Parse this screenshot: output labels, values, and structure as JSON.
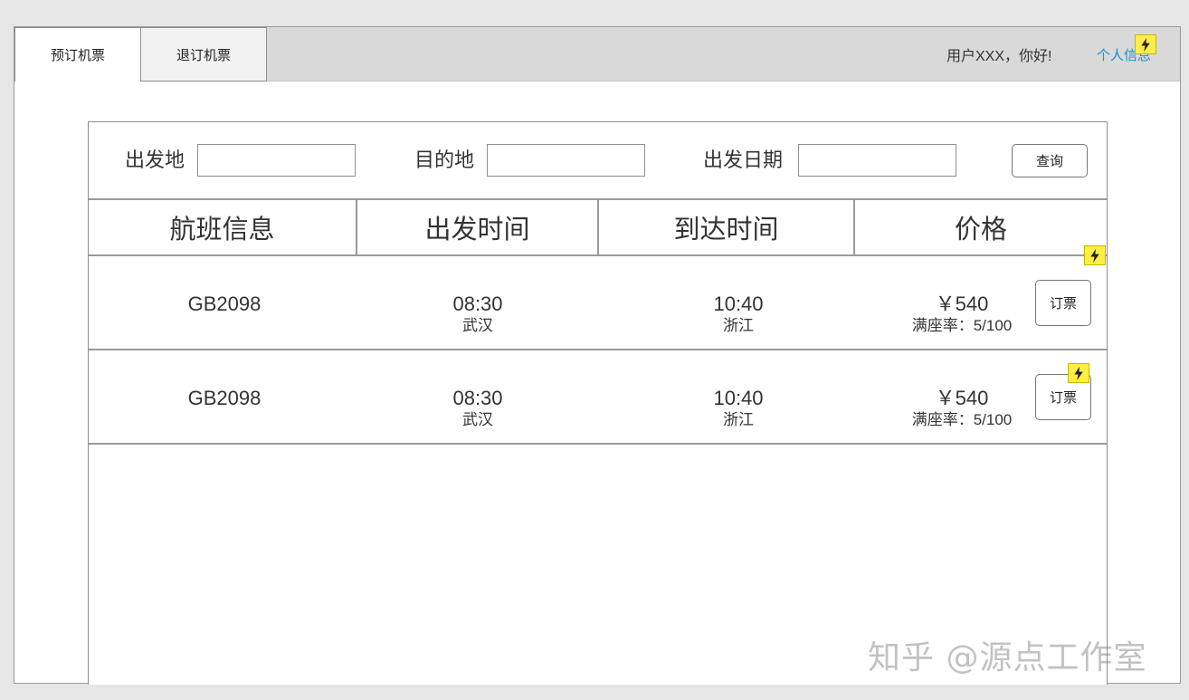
{
  "tabs": [
    {
      "label": "预订机票",
      "active": true
    },
    {
      "label": "退订机票",
      "active": false
    }
  ],
  "header": {
    "greeting": "用户XXX，你好!",
    "profile_link": "个人信息"
  },
  "search": {
    "origin_label": "出发地",
    "origin_value": "",
    "destination_label": "目的地",
    "destination_value": "",
    "date_label": "出发日期",
    "date_value": "",
    "query_button": "查询"
  },
  "table": {
    "columns": [
      "航班信息",
      "出发时间",
      "到达时间",
      "价格"
    ],
    "rows": [
      {
        "flight_no": "GB2098",
        "depart_time": "08:30",
        "depart_city": "武汉",
        "arrive_time": "10:40",
        "arrive_city": "浙江",
        "price": "￥540",
        "occupancy": "满座率：5/100",
        "book_button": "订票"
      },
      {
        "flight_no": "GB2098",
        "depart_time": "08:30",
        "depart_city": "武汉",
        "arrive_time": "10:40",
        "arrive_city": "浙江",
        "price": "￥540",
        "occupancy": "满座率：5/100",
        "book_button": "订票"
      }
    ]
  },
  "watermark": "知乎 @源点工作室",
  "colors": {
    "link": "#1a8fd6",
    "bolt_badge": "#ffee44",
    "topbar": "#d9d9d9"
  },
  "icons": [
    "lightning-bolt-icon"
  ]
}
